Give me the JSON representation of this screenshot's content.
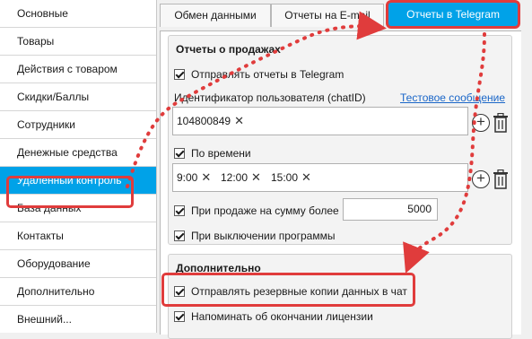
{
  "sidebar": {
    "items": [
      {
        "label": "Основные"
      },
      {
        "label": "Товары"
      },
      {
        "label": "Действия с товаром"
      },
      {
        "label": "Скидки/Баллы"
      },
      {
        "label": "Сотрудники"
      },
      {
        "label": "Денежные средства"
      },
      {
        "label": "Удаленный контроль"
      },
      {
        "label": "База данных"
      },
      {
        "label": "Контакты"
      },
      {
        "label": "Оборудование"
      },
      {
        "label": "Дополнительно"
      },
      {
        "label": "Внешний..."
      }
    ],
    "active_index": 6
  },
  "tabs": [
    {
      "label": "Обмен данными"
    },
    {
      "label": "Отчеты на E-mail"
    },
    {
      "label": "Отчеты в Telegram"
    }
  ],
  "sales_reports": {
    "title": "Отчеты о продажах",
    "send_reports_label": "Отправлять отчеты в Telegram",
    "chat_id_label": "Идентификатор пользователя (chatID)",
    "test_message_link": "Тестовое сообщение",
    "chat_ids": [
      "104800849"
    ],
    "by_time_label": "По времени",
    "times": [
      "9:00",
      "12:00",
      "15:00"
    ],
    "on_sale_label": "При продаже на сумму более",
    "sale_amount": "5000",
    "on_shutdown_label": "При выключении программы"
  },
  "additional": {
    "title": "Дополнительно",
    "backup_label": "Отправлять резервные копии данных в чат",
    "license_label": "Напоминать об окончании лицензии"
  },
  "colors": {
    "accent": "#00a2e8",
    "highlight": "#e03c3c"
  }
}
